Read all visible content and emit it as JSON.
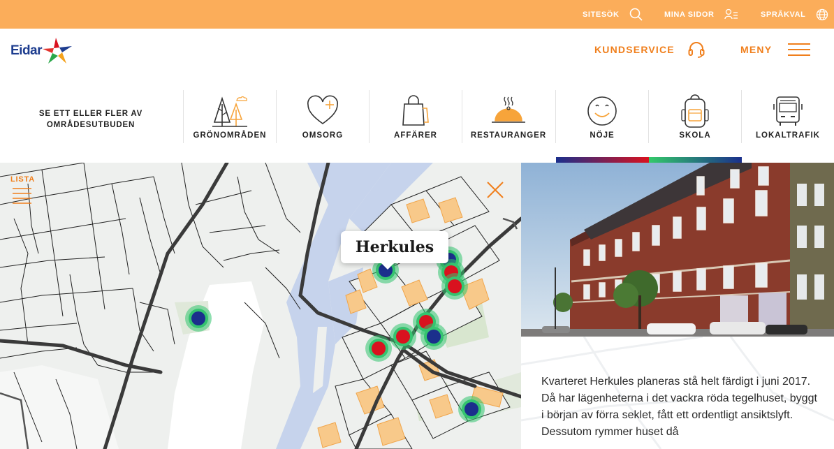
{
  "topbar": {
    "sitesok": "SITESÖK",
    "mina_sidor": "MINA SIDOR",
    "sprakval": "SPRÅKVAL"
  },
  "header": {
    "logo": "Eidar",
    "kundservice": "KUNDSERVICE",
    "meny": "MENY"
  },
  "categories": {
    "intro": "SE ETT ELLER FLER AV OMRÅDESUTBUDEN",
    "items": [
      {
        "label": "GRÖNOMRÅDEN",
        "icon": "trees-icon"
      },
      {
        "label": "OMSORG",
        "icon": "heart-plus-icon"
      },
      {
        "label": "AFFÄRER",
        "icon": "shopping-bag-icon"
      },
      {
        "label": "RESTAURANGER",
        "icon": "cloche-icon"
      },
      {
        "label": "NÖJE",
        "icon": "smiley-icon"
      },
      {
        "label": "SKOLA",
        "icon": "backpack-icon"
      },
      {
        "label": "LOKALTRAFIK",
        "icon": "bus-icon"
      }
    ],
    "selected": [
      "NÖJE",
      "SKOLA"
    ]
  },
  "map": {
    "lista": "LISTA",
    "tooltip": "Herkules"
  },
  "detail": {
    "description": "Kvarteret Herkules planeras stå helt färdigt i juni 2017. Då har lägenheterna i det vackra röda tegelhuset, byggt i början av förra seklet, fått ett ordentligt ansiktslyft. Dessutom rymmer huset då"
  },
  "colors": {
    "topbar": "#fbad5a",
    "accent": "#f07f1c",
    "logo_blue": "#1e3d8f",
    "marker_green": "#35c46f",
    "marker_red": "#d9121f",
    "marker_blue": "#1b2f8c"
  }
}
